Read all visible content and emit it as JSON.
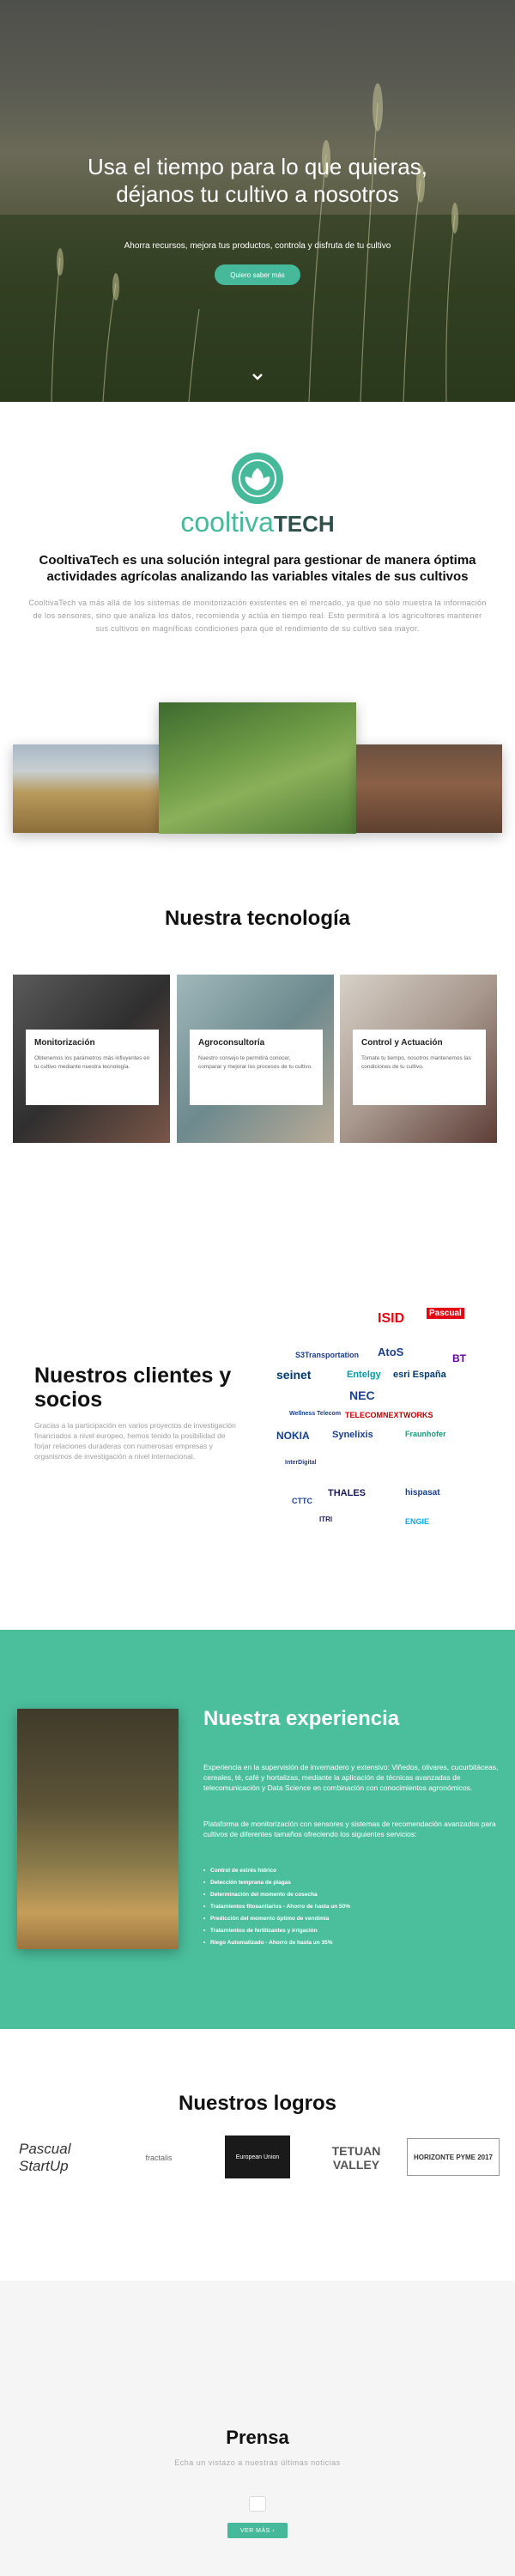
{
  "hero": {
    "title": "Usa el tiempo para lo que quieras, déjanos tu cultivo a nosotros",
    "subtitle": "Ahorra recursos, mejora tus productos, controla y disfruta de tu cultivo",
    "cta_label": "Quiero saber más",
    "scroll_icon": "chevron-down-icon"
  },
  "about": {
    "logo_word_1": "cooltiva",
    "logo_word_2": "TECH",
    "title": "CooltivaTech es una solución integral para gestionar de manera óptima actividades agrícolas analizando las variables vitales de sus cultivos",
    "body": "CooltivaTech va más allá de los sistemas de monitorización existentes en el mercado, ya que no sólo muestra la información de los sensores, sino que analiza los datos, recomienda y actúa en tiempo real. Esto permitirá a los agricultores mantener sus cultivos en magníficas condiciones para que el rendimiento de su cultivo sea mayor."
  },
  "technology": {
    "title": "Nuestra tecnología",
    "cards": [
      {
        "title": "Monitorización",
        "text": "Obtenemos los parámetros más influyentes en tu cultivo mediante nuestra tecnología."
      },
      {
        "title": "Agroconsultoría",
        "text": "Nuestro consejo te permitirá conocer, comparar y mejorar los procesos de tu cultivo."
      },
      {
        "title": "Control y Actuación",
        "text": "Tomate tu tiempo, nosotros mantenemos las condiciones de tu cultivo."
      }
    ]
  },
  "clients": {
    "title": "Nuestros clientes y socios",
    "body": "Gracias a la participación en varios proyectos de investigación financiados a nivel europeo, hemos tenido la posibilidad de forjar relaciones duraderas con numerosas empresas y organismos de investigación a nivel internacional.",
    "logos": [
      "ISID",
      "Pascual",
      "S3Transportation",
      "AtoS",
      "seinet",
      "Entelgy",
      "esri España",
      "BT",
      "NEC",
      "NOKIA",
      "Synelixis",
      "Fraunhofer",
      "TELECOMNEXTWORKS",
      "THALES",
      "hispasat",
      "CTTC",
      "ITRI",
      "ENGIE",
      "Wellness Telecom",
      "InterDigital"
    ]
  },
  "experience": {
    "title": "Nuestra experiencia",
    "paragraph_1": "Experiencia en la supervisión de invernadero y extensivo: Viñedos, olivares, cucurbitáceas, cereales, té, café y hortalizas, mediante la aplicación de técnicas avanzadas de telecomunicación y Data Science en combinación con conocimientos agronómicos.",
    "paragraph_2": "Plataforma de monitorización con sensores y sistemas de recomendación avanzados para cultivos de diferentes tamaños ofreciendo los siguientes servicios:",
    "services": [
      "Control de estrés hídrico",
      "Detección temprana de plagas",
      "Determinación del momento de cosecha",
      "Tratamientos fitosanitarios - Ahorro de hasta un 50%",
      "Predicción del momento óptimo de vendimia",
      "Tratamientos de fertilizantes y irrigación",
      "Riego Automatizado - Ahorro de hasta un 35%"
    ]
  },
  "achievements": {
    "title": "Nuestros logros",
    "items": [
      "Pascual StartUp",
      "fractalis",
      "European Union",
      "TETUAN VALLEY",
      "HORIZONTE PYME 2017"
    ]
  },
  "press": {
    "title": "Prensa",
    "subtitle": "Echa un vistazo a nuestras últimas noticias",
    "button_label": "VER MÁS"
  },
  "colors": {
    "accent": "#45b99a",
    "band": "#4bbf9c"
  }
}
